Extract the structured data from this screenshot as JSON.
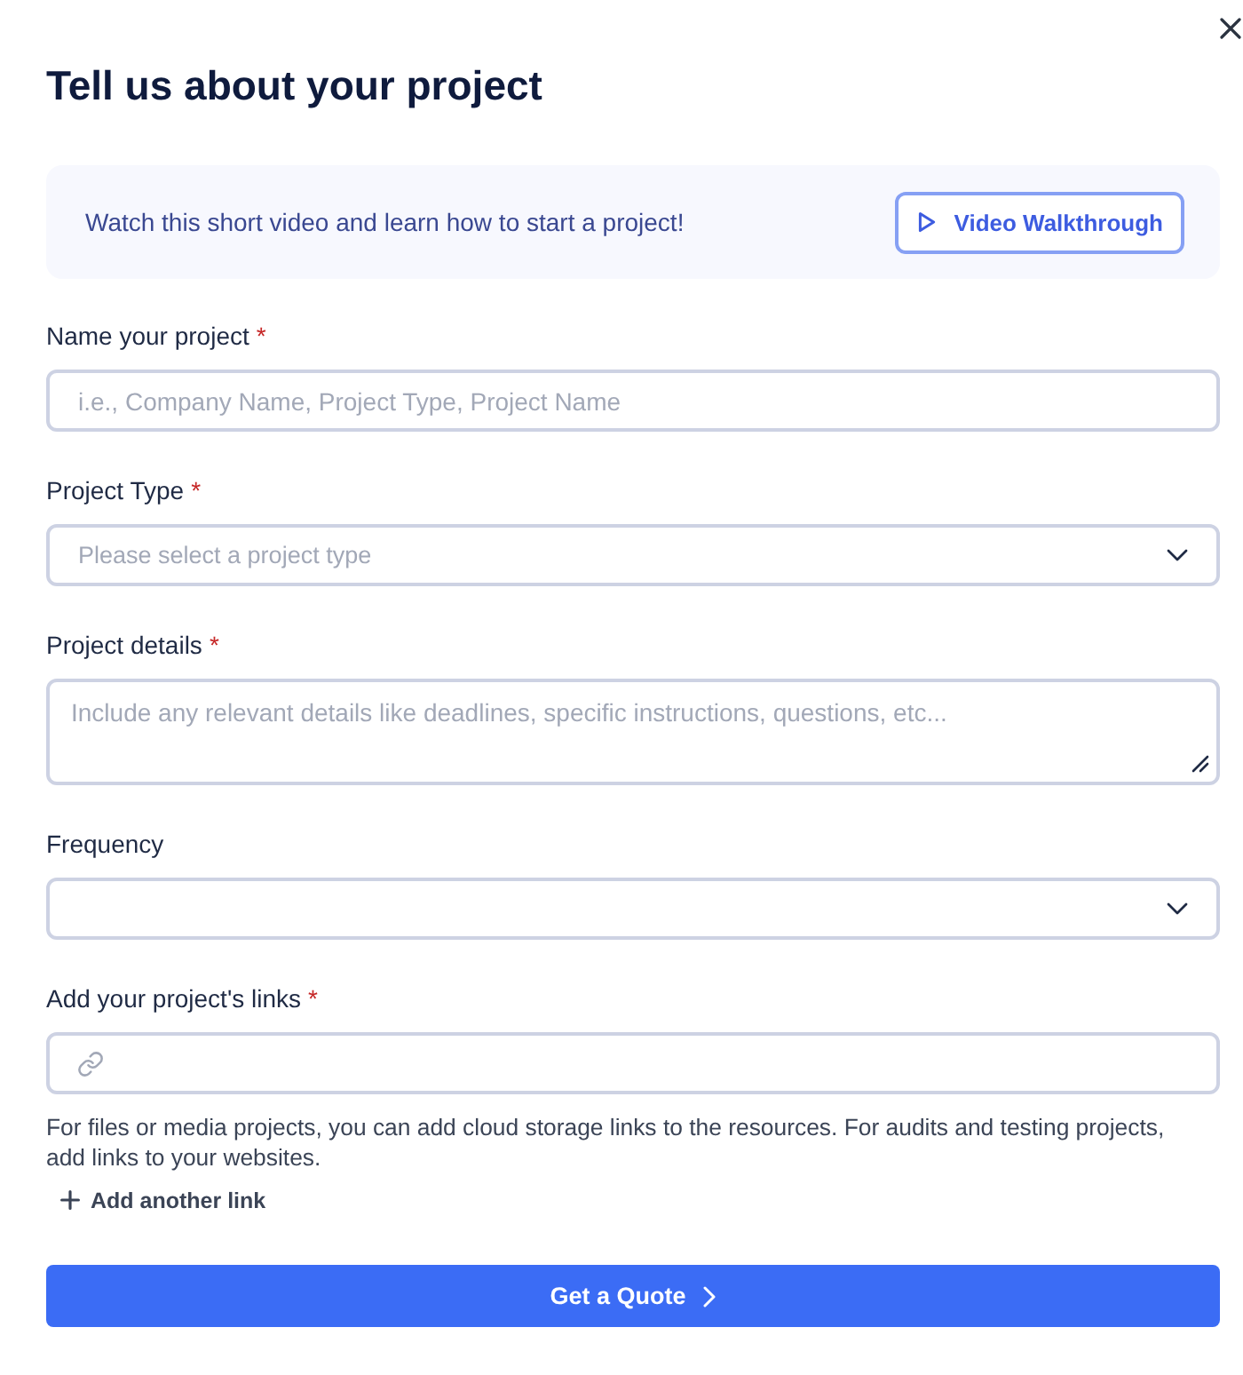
{
  "title": "Tell us about your project",
  "banner": {
    "text": "Watch this short video and learn how to start a project!",
    "button": {
      "label": "Video Walkthrough"
    }
  },
  "fields": [
    {
      "kind": "text",
      "label": "Name your project",
      "required_mark": "*",
      "placeholder": "i.e., Company Name, Project Type, Project Name"
    },
    {
      "kind": "select",
      "label": "Project Type",
      "required_mark": "*",
      "placeholder": "Please select a project type"
    },
    {
      "kind": "textarea",
      "label": "Project details",
      "required_mark": "*",
      "placeholder": "Include any relevant details like deadlines, specific instructions, questions, etc..."
    },
    {
      "kind": "select",
      "label": "Frequency"
    },
    {
      "kind": "link",
      "label": "Add your project's links",
      "required_mark": "*",
      "help": "For files or media projects, you can add cloud storage links to the resources. For audits and testing projects, add links to your websites.",
      "add_button": {
        "label": "Add another link"
      }
    }
  ],
  "submit": {
    "label": "Get a Quote"
  }
}
